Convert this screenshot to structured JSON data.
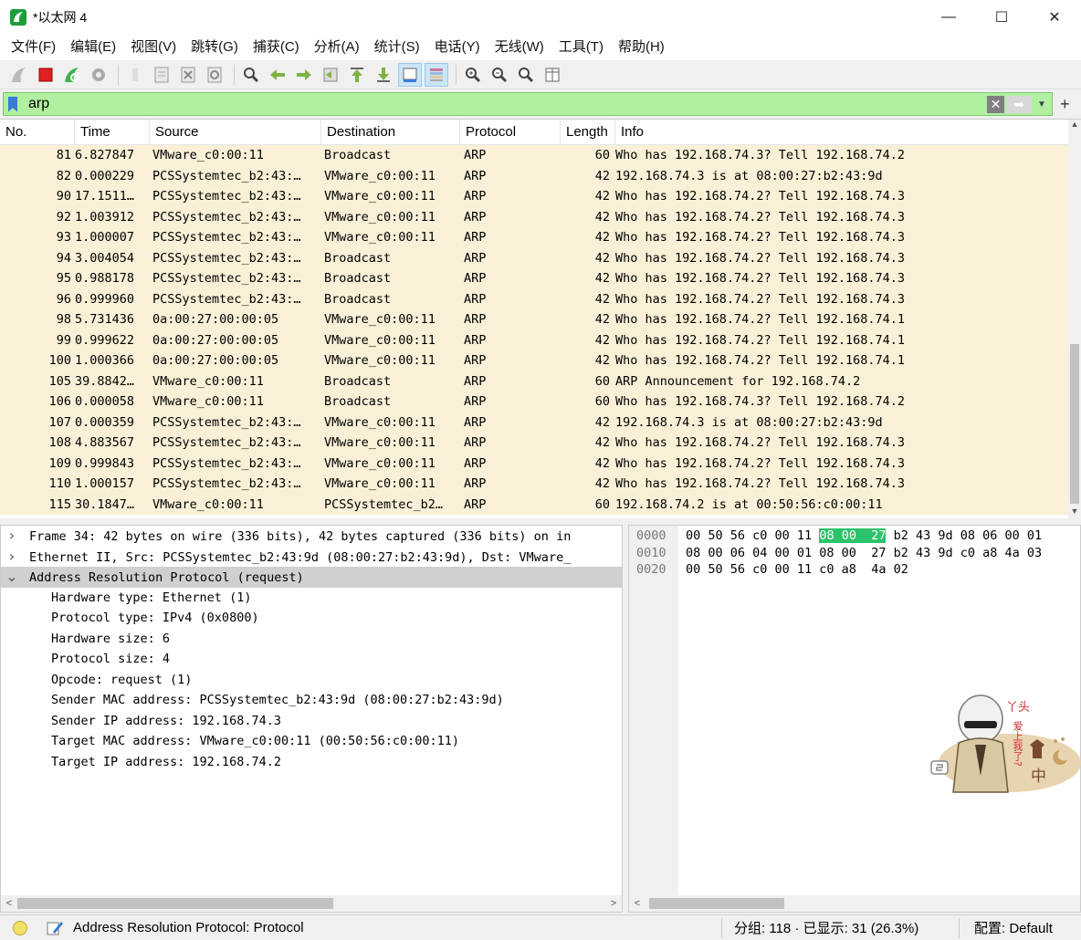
{
  "window": {
    "title": "*以太网 4",
    "minimize": "—",
    "maximize": "☐",
    "close": "✕"
  },
  "menu": [
    "文件(F)",
    "编辑(E)",
    "视图(V)",
    "跳转(G)",
    "捕获(C)",
    "分析(A)",
    "统计(S)",
    "电话(Y)",
    "无线(W)",
    "工具(T)",
    "帮助(H)"
  ],
  "toolbar_icons": [
    "shark-fin-start-icon",
    "stop-capture-icon",
    "restart-capture-icon",
    "capture-options-icon",
    "open-file-icon",
    "save-file-icon",
    "close-file-icon",
    "reload-icon",
    "find-packet-icon",
    "go-back-icon",
    "go-forward-icon",
    "go-to-packet-icon",
    "first-packet-icon",
    "last-packet-icon",
    "autoscroll-icon",
    "colorize-icon",
    "zoom-in-icon",
    "zoom-out-icon",
    "normal-size-icon",
    "resize-columns-icon"
  ],
  "filter": {
    "value": "arp",
    "plus": "+"
  },
  "packet_list": {
    "columns": [
      "No.",
      "Time",
      "Source",
      "Destination",
      "Protocol",
      "Length",
      "Info"
    ],
    "rows": [
      [
        "81",
        "6.827847",
        "VMware_c0:00:11",
        "Broadcast",
        "ARP",
        "60",
        "Who has 192.168.74.3? Tell 192.168.74.2"
      ],
      [
        "82",
        "0.000229",
        "PCSSystemtec_b2:43:…",
        "VMware_c0:00:11",
        "ARP",
        "42",
        "192.168.74.3 is at 08:00:27:b2:43:9d"
      ],
      [
        "90",
        "17.1511…",
        "PCSSystemtec_b2:43:…",
        "VMware_c0:00:11",
        "ARP",
        "42",
        "Who has 192.168.74.2? Tell 192.168.74.3"
      ],
      [
        "92",
        "1.003912",
        "PCSSystemtec_b2:43:…",
        "VMware_c0:00:11",
        "ARP",
        "42",
        "Who has 192.168.74.2? Tell 192.168.74.3"
      ],
      [
        "93",
        "1.000007",
        "PCSSystemtec_b2:43:…",
        "VMware_c0:00:11",
        "ARP",
        "42",
        "Who has 192.168.74.2? Tell 192.168.74.3"
      ],
      [
        "94",
        "3.004054",
        "PCSSystemtec_b2:43:…",
        "Broadcast",
        "ARP",
        "42",
        "Who has 192.168.74.2? Tell 192.168.74.3"
      ],
      [
        "95",
        "0.988178",
        "PCSSystemtec_b2:43:…",
        "Broadcast",
        "ARP",
        "42",
        "Who has 192.168.74.2? Tell 192.168.74.3"
      ],
      [
        "96",
        "0.999960",
        "PCSSystemtec_b2:43:…",
        "Broadcast",
        "ARP",
        "42",
        "Who has 192.168.74.2? Tell 192.168.74.3"
      ],
      [
        "98",
        "5.731436",
        "0a:00:27:00:00:05",
        "VMware_c0:00:11",
        "ARP",
        "42",
        "Who has 192.168.74.2? Tell 192.168.74.1"
      ],
      [
        "99",
        "0.999622",
        "0a:00:27:00:00:05",
        "VMware_c0:00:11",
        "ARP",
        "42",
        "Who has 192.168.74.2? Tell 192.168.74.1"
      ],
      [
        "100",
        "1.000366",
        "0a:00:27:00:00:05",
        "VMware_c0:00:11",
        "ARP",
        "42",
        "Who has 192.168.74.2? Tell 192.168.74.1"
      ],
      [
        "105",
        "39.8842…",
        "VMware_c0:00:11",
        "Broadcast",
        "ARP",
        "60",
        "ARP Announcement for 192.168.74.2"
      ],
      [
        "106",
        "0.000058",
        "VMware_c0:00:11",
        "Broadcast",
        "ARP",
        "60",
        "Who has 192.168.74.3? Tell 192.168.74.2"
      ],
      [
        "107",
        "0.000359",
        "PCSSystemtec_b2:43:…",
        "VMware_c0:00:11",
        "ARP",
        "42",
        "192.168.74.3 is at 08:00:27:b2:43:9d"
      ],
      [
        "108",
        "4.883567",
        "PCSSystemtec_b2:43:…",
        "VMware_c0:00:11",
        "ARP",
        "42",
        "Who has 192.168.74.2? Tell 192.168.74.3"
      ],
      [
        "109",
        "0.999843",
        "PCSSystemtec_b2:43:…",
        "VMware_c0:00:11",
        "ARP",
        "42",
        "Who has 192.168.74.2? Tell 192.168.74.3"
      ],
      [
        "110",
        "1.000157",
        "PCSSystemtec_b2:43:…",
        "VMware_c0:00:11",
        "ARP",
        "42",
        "Who has 192.168.74.2? Tell 192.168.74.3"
      ],
      [
        "115",
        "30.1847…",
        "VMware_c0:00:11",
        "PCSSystemtec_b2…",
        "ARP",
        "60",
        "192.168.74.2 is at 00:50:56:c0:00:11"
      ]
    ]
  },
  "details": {
    "top": [
      {
        "arrow": ">",
        "text": "Frame 34: 42 bytes on wire (336 bits), 42 bytes captured (336 bits) on in"
      },
      {
        "arrow": ">",
        "text": "Ethernet II, Src: PCSSystemtec_b2:43:9d (08:00:27:b2:43:9d), Dst: VMware_"
      },
      {
        "arrow": "v",
        "text": "Address Resolution Protocol (request)"
      }
    ],
    "children": [
      "Hardware type: Ethernet (1)",
      "Protocol type: IPv4 (0x0800)",
      "Hardware size: 6",
      "Protocol size: 4",
      "Opcode: request (1)",
      "Sender MAC address: PCSSystemtec_b2:43:9d (08:00:27:b2:43:9d)",
      "Sender IP address: 192.168.74.3",
      "Target MAC address: VMware_c0:00:11 (00:50:56:c0:00:11)",
      "Target IP address: 192.168.74.2"
    ]
  },
  "bytes": {
    "offsets": [
      "0000",
      "0010",
      "0020"
    ],
    "lines": [
      {
        "pre": "00 50 56 c0 00 11 ",
        "hl": "08 00  27",
        "post": " b2 43 9d 08 06 00 01"
      },
      {
        "pre": "08 00 06 04 00 01 08 00  27 b2 43 9d c0 a8 4a 03",
        "hl": "",
        "post": ""
      },
      {
        "pre": "00 50 56 c0 00 11 c0 a8  4a 02",
        "hl": "",
        "post": ""
      }
    ]
  },
  "sticker": {
    "text1": "丫头",
    "text2": "爱上我了?",
    "text3": "中"
  },
  "status": {
    "left_text": "Address Resolution Protocol: Protocol",
    "packets": "分组: 118 · 已显示: 31 (26.3%)",
    "profile": "配置: Default"
  },
  "colors": {
    "row_bg": "#faf0d7",
    "filter_bg": "#b0f0a0",
    "byte_highlight": "#2dc26b"
  }
}
